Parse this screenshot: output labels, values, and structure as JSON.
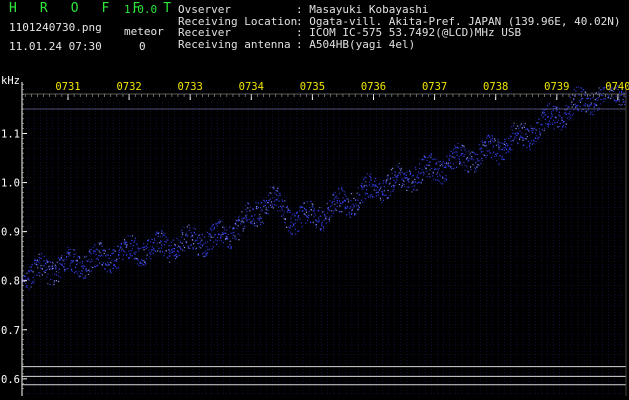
{
  "app": {
    "title": "H R O F F T",
    "version": "1.0.0",
    "filename": "1101240730.png",
    "timestamp": "11.01.24 07:30",
    "meteor_label": "meteor",
    "meteor_count": "0"
  },
  "meta": [
    {
      "key": "Ovserver",
      "value": ": Masayuki Kobayashi"
    },
    {
      "key": "Receiving Location",
      "value": ": Ogata-vill. Akita-Pref. JAPAN (139.96E, 40.02N)"
    },
    {
      "key": "Receiver",
      "value": ": ICOM IC-575 53.7492(@LCD)MHz USB"
    },
    {
      "key": "Receiving antenna",
      "value": ": A504HB(yagi 4el)"
    }
  ],
  "colors": {
    "background": "#000000",
    "logo": "#2ee83a",
    "time_labels": "#f2e600",
    "axis": "#ffffff",
    "grid": "#1a1a5a",
    "signal": "#3a44ff",
    "signal_bright": "#9aa4ff",
    "ref_lines": "#d8d8d8"
  },
  "chart_data": {
    "type": "scatter",
    "title": "",
    "ylabel": "kHz",
    "xlabel": "",
    "x_ticks": [
      "0731",
      "0732",
      "0733",
      "0734",
      "0735",
      "0736",
      "0737",
      "0738",
      "0739",
      "0740"
    ],
    "x_range_minutes": [
      7.5,
      10.15
    ],
    "y_ticks": [
      0.6,
      0.7,
      0.8,
      0.9,
      1.0,
      1.1
    ],
    "ylim": [
      0.565,
      1.205
    ],
    "reference_lines_khz": [
      1.15,
      0.625,
      0.605,
      0.588
    ],
    "series": [
      {
        "x": [
          30.0,
          30.5,
          31.0,
          31.5,
          32.0,
          32.5,
          33.0,
          33.5,
          34.0,
          34.3,
          34.6,
          35.0,
          35.5,
          36.0,
          36.5,
          37.0,
          37.5,
          38.0,
          38.5,
          39.0,
          39.5,
          40.0,
          40.2
        ],
        "y": [
          0.78,
          0.82,
          0.835,
          0.845,
          0.86,
          0.87,
          0.88,
          0.89,
          0.93,
          0.97,
          0.93,
          0.93,
          0.96,
          0.99,
          1.01,
          1.03,
          1.05,
          1.07,
          1.1,
          1.14,
          1.17,
          1.19,
          1.2
        ]
      }
    ],
    "grid": true
  }
}
